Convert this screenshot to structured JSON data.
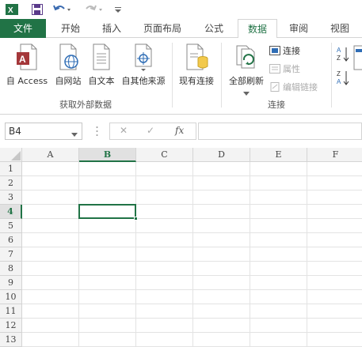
{
  "app": {
    "accent": "#217346"
  },
  "tabs": [
    {
      "label": "文件"
    },
    {
      "label": "开始"
    },
    {
      "label": "插入"
    },
    {
      "label": "页面布局"
    },
    {
      "label": "公式"
    },
    {
      "label": "数据"
    },
    {
      "label": "审阅"
    },
    {
      "label": "视图"
    }
  ],
  "ribbon": {
    "external": {
      "label": "获取外部数据",
      "buttons": [
        {
          "label": "自 Access",
          "icon": "access-db-icon"
        },
        {
          "label": "自网站",
          "icon": "web-globe-icon"
        },
        {
          "label": "自文本",
          "icon": "text-file-icon"
        },
        {
          "label": "自其他来源",
          "icon": "other-sources-icon"
        }
      ]
    },
    "existing": {
      "label": "现有连接",
      "icon": "existing-connection-icon"
    },
    "connections": {
      "label": "连接",
      "refresh": "全部刷新",
      "items": [
        {
          "label": "连接",
          "enabled": true
        },
        {
          "label": "属性",
          "enabled": false
        },
        {
          "label": "编辑链接",
          "enabled": false
        }
      ]
    }
  },
  "formula_bar": {
    "name_box": "B4",
    "cancel": "✕",
    "enter": "✓",
    "fx": "fx",
    "value": ""
  },
  "sheet": {
    "columns": [
      "A",
      "B",
      "C",
      "D",
      "E",
      "F"
    ],
    "rows": [
      "1",
      "2",
      "3",
      "4",
      "5",
      "6",
      "7",
      "8",
      "9",
      "10",
      "11",
      "12",
      "13"
    ],
    "active_cell": "B4"
  }
}
